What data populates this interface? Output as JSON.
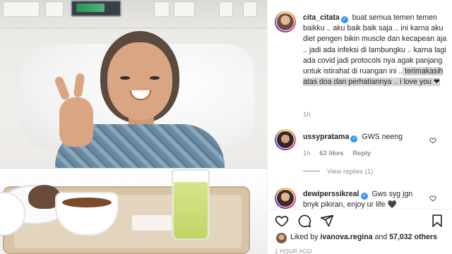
{
  "post": {
    "author": "cita_citata",
    "caption_parts": {
      "plain": "buat semua temen temen baikku .. aku baik baik saja .. ini karna aku diet pengen bikin muscle dan kecapean aja .. jadi ada infeksi di lambungku .. karna lagi ada covid jadi protocols nya agak panjang untuk istirahat di ruangan ini ..",
      "highlighted": " terimakasih atas doa dan perhatiannya .. i love you ",
      "emoji": "❤"
    },
    "time": "1h",
    "verified_mark": "✓"
  },
  "comments": [
    {
      "user": "ussypratama",
      "text": "GWS neeng",
      "time": "1h",
      "likes": "62 likes",
      "reply": "Reply",
      "view_replies": "View replies (1)"
    },
    {
      "user": "dewiperssikreal",
      "text": "Gws syg jgn bnyk pikiran, enjoy ur life 🖤"
    }
  ],
  "footer": {
    "liked_prefix": "Liked by ",
    "liked_user": "ivanova.regina",
    "liked_and": " and ",
    "liked_count": "57,032 others",
    "ago": "1 HOUR AGO"
  },
  "icons": {
    "like": "heart-icon",
    "comment": "comment-icon",
    "share": "share-icon",
    "save": "bookmark-icon"
  },
  "colors": {
    "verified": "#3897f0",
    "muted": "#8e8e8e",
    "text": "#262626",
    "highlight": "#d6d6d6"
  }
}
